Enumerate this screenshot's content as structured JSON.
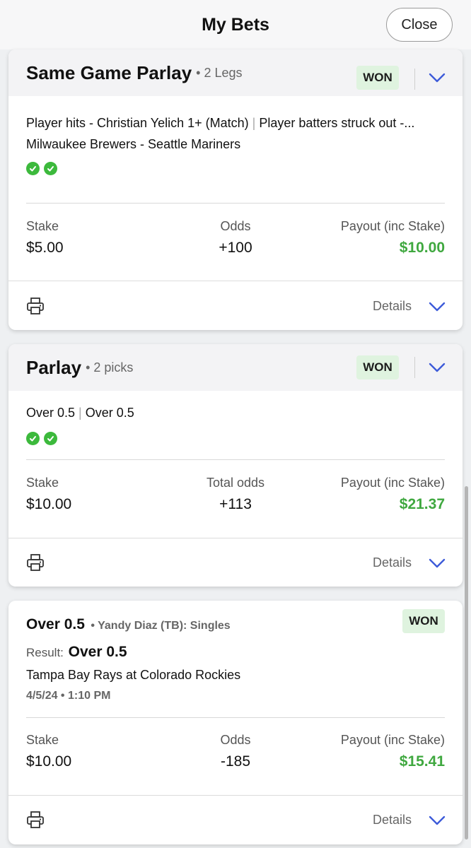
{
  "header": {
    "title": "My Bets",
    "close_label": "Close"
  },
  "bets": [
    {
      "title": "Same Game Parlay",
      "meta": "• 2 Legs",
      "status": "WON",
      "legs": [
        "Player hits - Christian Yelich 1+ (Match)",
        "Player batters struck out -..."
      ],
      "event": "Milwaukee Brewers - Seattle Mariners",
      "stake_label": "Stake",
      "stake": "$5.00",
      "odds_label": "Odds",
      "odds": "+100",
      "payout_label": "Payout (inc Stake)",
      "payout": "$10.00",
      "details_label": "Details"
    },
    {
      "title": "Parlay",
      "meta": "• 2 picks",
      "status": "WON",
      "legs": [
        "Over 0.5",
        "Over 0.5"
      ],
      "stake_label": "Stake",
      "stake": "$10.00",
      "odds_label": "Total odds",
      "odds": "+113",
      "payout_label": "Payout (inc Stake)",
      "payout": "$21.37",
      "details_label": "Details"
    },
    {
      "title": "Over 0.5",
      "meta": "• Yandy Diaz (TB): Singles",
      "status": "WON",
      "result_label": "Result:",
      "result": "Over 0.5",
      "event": "Tampa Bay Rays at Colorado Rockies",
      "datetime": "4/5/24 • 1:10 PM",
      "stake_label": "Stake",
      "stake": "$10.00",
      "odds_label": "Odds",
      "odds": "-185",
      "payout_label": "Payout (inc Stake)",
      "payout": "$15.41",
      "details_label": "Details"
    }
  ],
  "colors": {
    "payout_green": "#3fa83f",
    "won_bg": "#dff3df",
    "check_green": "#3cb93c",
    "chevron_blue": "#3d5bd9"
  },
  "icons": [
    "chevron-down-icon",
    "check-icon",
    "printer-icon"
  ]
}
